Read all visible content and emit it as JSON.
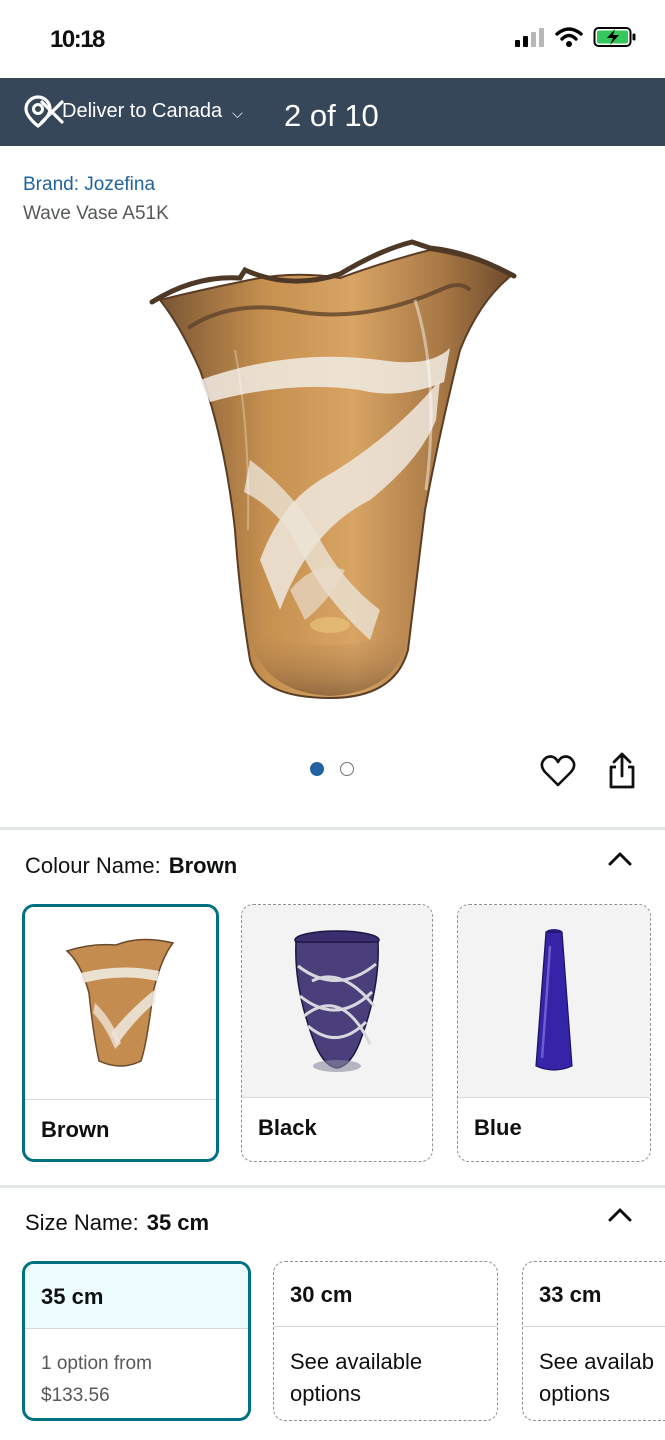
{
  "status_bar": {
    "time": "10:18"
  },
  "nav": {
    "deliver_label": "Deliver to Canada",
    "caret": "⌵",
    "counter": "2 of 10"
  },
  "product": {
    "brand": "Brand: Jozefina",
    "title": "Wave Vase A51K"
  },
  "carousel": {
    "total_dots": 2,
    "active_index": 0
  },
  "colour": {
    "label": "Colour Name:",
    "selected": "Brown",
    "options": [
      {
        "name": "Brown",
        "selected": true
      },
      {
        "name": "Black",
        "selected": false
      },
      {
        "name": "Blue",
        "selected": false
      }
    ]
  },
  "size": {
    "label": "Size Name:",
    "selected": "35 cm",
    "options": [
      {
        "name": "35 cm",
        "line1": "1 option from",
        "line2": "$133.56",
        "selected": true
      },
      {
        "name": "30 cm",
        "line1": "See available",
        "line2": "options",
        "selected": false
      },
      {
        "name": "33 cm",
        "line1": "See availab",
        "line2": "options",
        "selected": false
      }
    ]
  },
  "colors": {
    "nav_bg": "#37475a",
    "link": "#2162a1",
    "selected_border": "#007185",
    "battery": "#34c759"
  }
}
